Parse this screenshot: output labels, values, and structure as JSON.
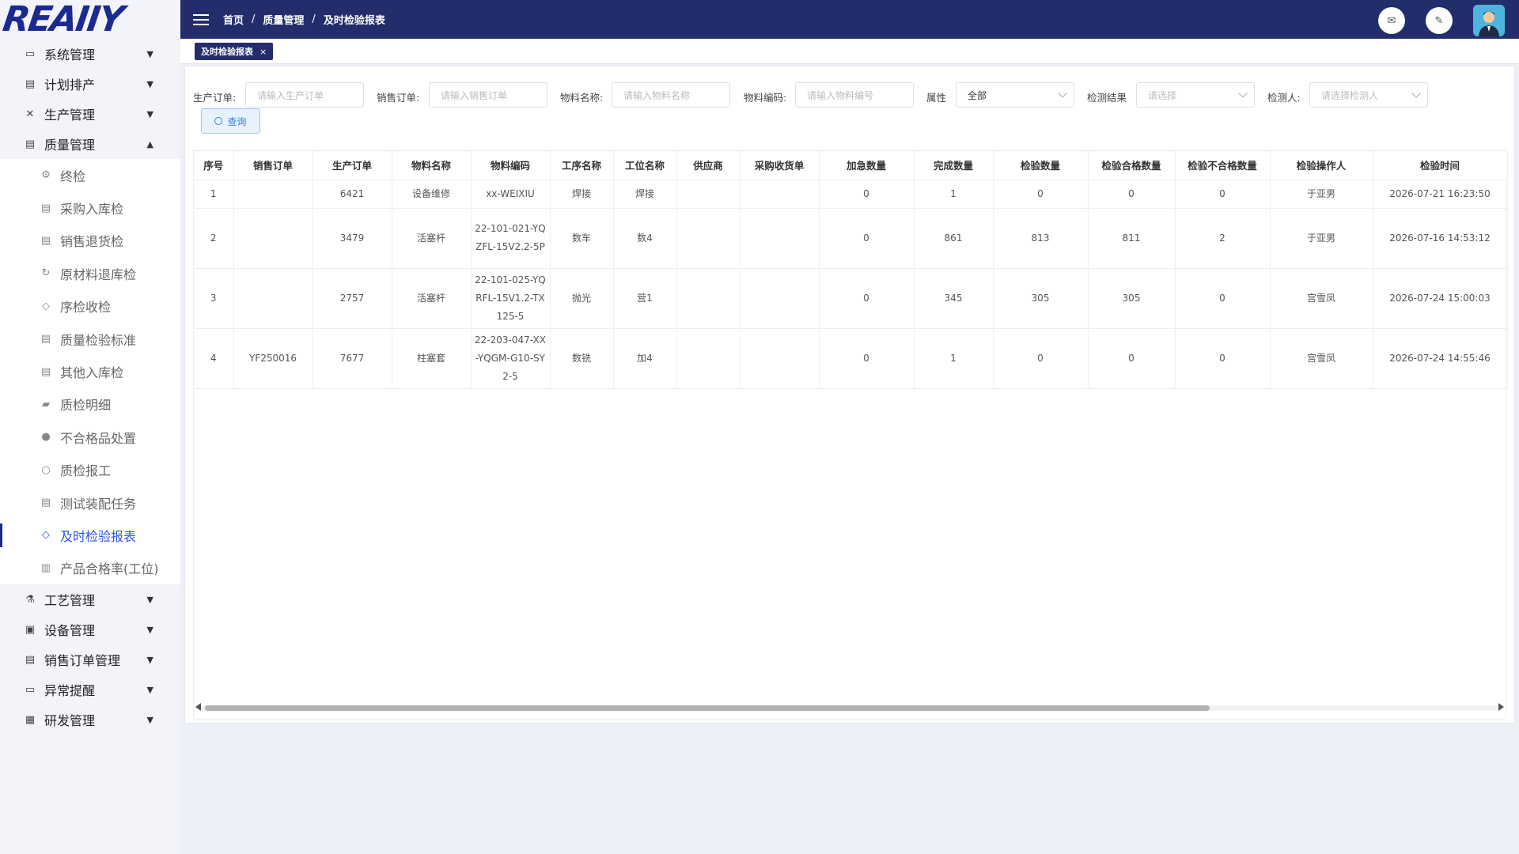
{
  "logo": {
    "text": "REAIIY"
  },
  "sidebar": {
    "items": [
      {
        "label": "系统管理",
        "icon": "monitor-icon"
      },
      {
        "label": "计划排产",
        "icon": "document-icon"
      },
      {
        "label": "生产管理",
        "icon": "tools-icon"
      },
      {
        "label": "质量管理",
        "icon": "clipboard-icon",
        "expanded": true
      }
    ],
    "quality_sub": [
      {
        "label": "终检",
        "icon": "gear-icon"
      },
      {
        "label": "采购入库检",
        "icon": "document-icon"
      },
      {
        "label": "销售退货检",
        "icon": "document-icon"
      },
      {
        "label": "原材料退库检",
        "icon": "refresh-icon"
      },
      {
        "label": "序检收检",
        "icon": "diamond-icon"
      },
      {
        "label": "质量检验标准",
        "icon": "document-icon"
      },
      {
        "label": "其他入库检",
        "icon": "document-icon"
      },
      {
        "label": "质检明细",
        "icon": "truck-icon"
      },
      {
        "label": "不合格品处置",
        "icon": "alert-icon"
      },
      {
        "label": "质检报工",
        "icon": "search-icon"
      },
      {
        "label": "测试装配任务",
        "icon": "document-icon"
      },
      {
        "label": "及时检验报表",
        "icon": "diamond-icon",
        "active": true
      },
      {
        "label": "产品合格率(工位)",
        "icon": "chart-icon"
      }
    ],
    "bottom_items": [
      {
        "label": "工艺管理",
        "icon": "flask-icon"
      },
      {
        "label": "设备管理",
        "icon": "machine-icon"
      },
      {
        "label": "销售订单管理",
        "icon": "document-icon"
      },
      {
        "label": "异常提醒",
        "icon": "monitor-icon"
      },
      {
        "label": "研发管理",
        "icon": "calendar-icon"
      }
    ]
  },
  "header": {
    "breadcrumb": [
      "首页",
      "质量管理",
      "及时检验报表"
    ],
    "separator": "/"
  },
  "tabs": [
    {
      "label": "及时检验报表",
      "close": "×"
    }
  ],
  "filters": {
    "production_order": {
      "label": "生产订单:",
      "placeholder": "请输入生产订单"
    },
    "sales_order": {
      "label": "销售订单:",
      "placeholder": "请输入销售订单"
    },
    "material_name": {
      "label": "物料名称:",
      "placeholder": "请输入物料名称"
    },
    "material_code": {
      "label": "物料编码:",
      "placeholder": "请输入物料编号"
    },
    "attribute": {
      "label": "属性",
      "value": "全部"
    },
    "result": {
      "label": "检测结果",
      "placeholder": "请选择"
    },
    "inspector": {
      "label": "检测人:",
      "placeholder": "请选择检测人"
    },
    "query_button": "查询"
  },
  "table": {
    "columns": [
      "序号",
      "销售订单",
      "生产订单",
      "物料名称",
      "物料编码",
      "工序名称",
      "工位名称",
      "供应商",
      "采购收货单",
      "加急数量",
      "完成数量",
      "检验数量",
      "检验合格数量",
      "检验不合格数量",
      "检验操作人",
      "检验时间"
    ],
    "rows": [
      [
        "1",
        "",
        "6421",
        "设备维修",
        "xx-WEIXIU",
        "焊接",
        "焊接",
        "",
        "",
        "0",
        "1",
        "0",
        "0",
        "0",
        "于亚男",
        "2026-07-21 16:23:50"
      ],
      [
        "2",
        "",
        "3479",
        "活塞杆",
        "22-101-021-YQZFL-15V2.2-5P",
        "数车",
        "数4",
        "",
        "",
        "0",
        "861",
        "813",
        "811",
        "2",
        "于亚男",
        "2026-07-16 14:53:12"
      ],
      [
        "3",
        "",
        "2757",
        "活塞杆",
        "22-101-025-YQRFL-15V1.2-TX125-5",
        "抛光",
        "营1",
        "",
        "",
        "0",
        "345",
        "305",
        "305",
        "0",
        "宫雪凤",
        "2026-07-24 15:00:03"
      ],
      [
        "4",
        "YF250016",
        "7677",
        "柱塞套",
        "22-203-047-XX-YQGM-G10-SY2-5",
        "数铣",
        "加4",
        "",
        "",
        "0",
        "1",
        "0",
        "0",
        "0",
        "宫雪凤",
        "2026-07-24 14:55:46"
      ]
    ]
  }
}
